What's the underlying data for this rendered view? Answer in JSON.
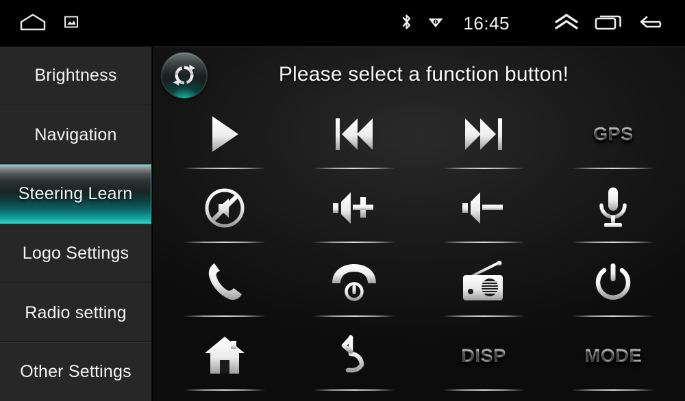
{
  "statusbar": {
    "left_icons": [
      {
        "name": "home-icon",
        "label": "Home"
      },
      {
        "name": "screenshot-icon",
        "label": "Screenshot"
      }
    ],
    "bluetooth_icon": "bluetooth-icon",
    "wifi_icon": "wifi-icon",
    "clock": "16:45",
    "expand_icon": "chevron-up-icon",
    "recents_icon": "recents-icon",
    "back_icon": "back-arrow-icon"
  },
  "sidebar": {
    "items": [
      {
        "label": "Brightness",
        "selected": false
      },
      {
        "label": "Navigation",
        "selected": false
      },
      {
        "label": "Steering Learn",
        "selected": true
      },
      {
        "label": "Logo Settings",
        "selected": false
      },
      {
        "label": "Radio setting",
        "selected": false
      },
      {
        "label": "Other Settings",
        "selected": false
      }
    ],
    "selected_index": 2,
    "selected_accent": "#2ad4c8"
  },
  "main": {
    "reset_button": {
      "name": "reset-button",
      "icon": "refresh-icon"
    },
    "title": "Please select a function button!",
    "grid": {
      "columns": 4,
      "rows": 4,
      "buttons": [
        {
          "icon": "play-icon",
          "label": "",
          "type": "icon"
        },
        {
          "icon": "previous-track-icon",
          "label": "",
          "type": "icon"
        },
        {
          "icon": "next-track-icon",
          "label": "",
          "type": "icon"
        },
        {
          "icon": "gps-text-icon",
          "label": "GPS",
          "type": "text"
        },
        {
          "icon": "mute-icon",
          "label": "",
          "type": "icon"
        },
        {
          "icon": "volume-up-icon",
          "label": "",
          "type": "icon"
        },
        {
          "icon": "volume-down-icon",
          "label": "",
          "type": "icon"
        },
        {
          "icon": "microphone-icon",
          "label": "",
          "type": "icon"
        },
        {
          "icon": "call-answer-icon",
          "label": "",
          "type": "icon"
        },
        {
          "icon": "call-hangup-icon",
          "label": "",
          "type": "icon"
        },
        {
          "icon": "radio-icon",
          "label": "",
          "type": "icon"
        },
        {
          "icon": "power-icon",
          "label": "",
          "type": "icon"
        },
        {
          "icon": "home-house-icon",
          "label": "",
          "type": "icon"
        },
        {
          "icon": "return-arrow-icon",
          "label": "",
          "type": "icon"
        },
        {
          "icon": "disp-text-icon",
          "label": "DISP",
          "type": "text"
        },
        {
          "icon": "mode-text-icon",
          "label": "MODE",
          "type": "text"
        }
      ]
    }
  },
  "colors": {
    "background": "#000000",
    "sidebar_bg": "#272727",
    "panel_bg": "#1b1b1b",
    "accent_teal": "#2ad4c8",
    "text": "#f4f4f4"
  }
}
